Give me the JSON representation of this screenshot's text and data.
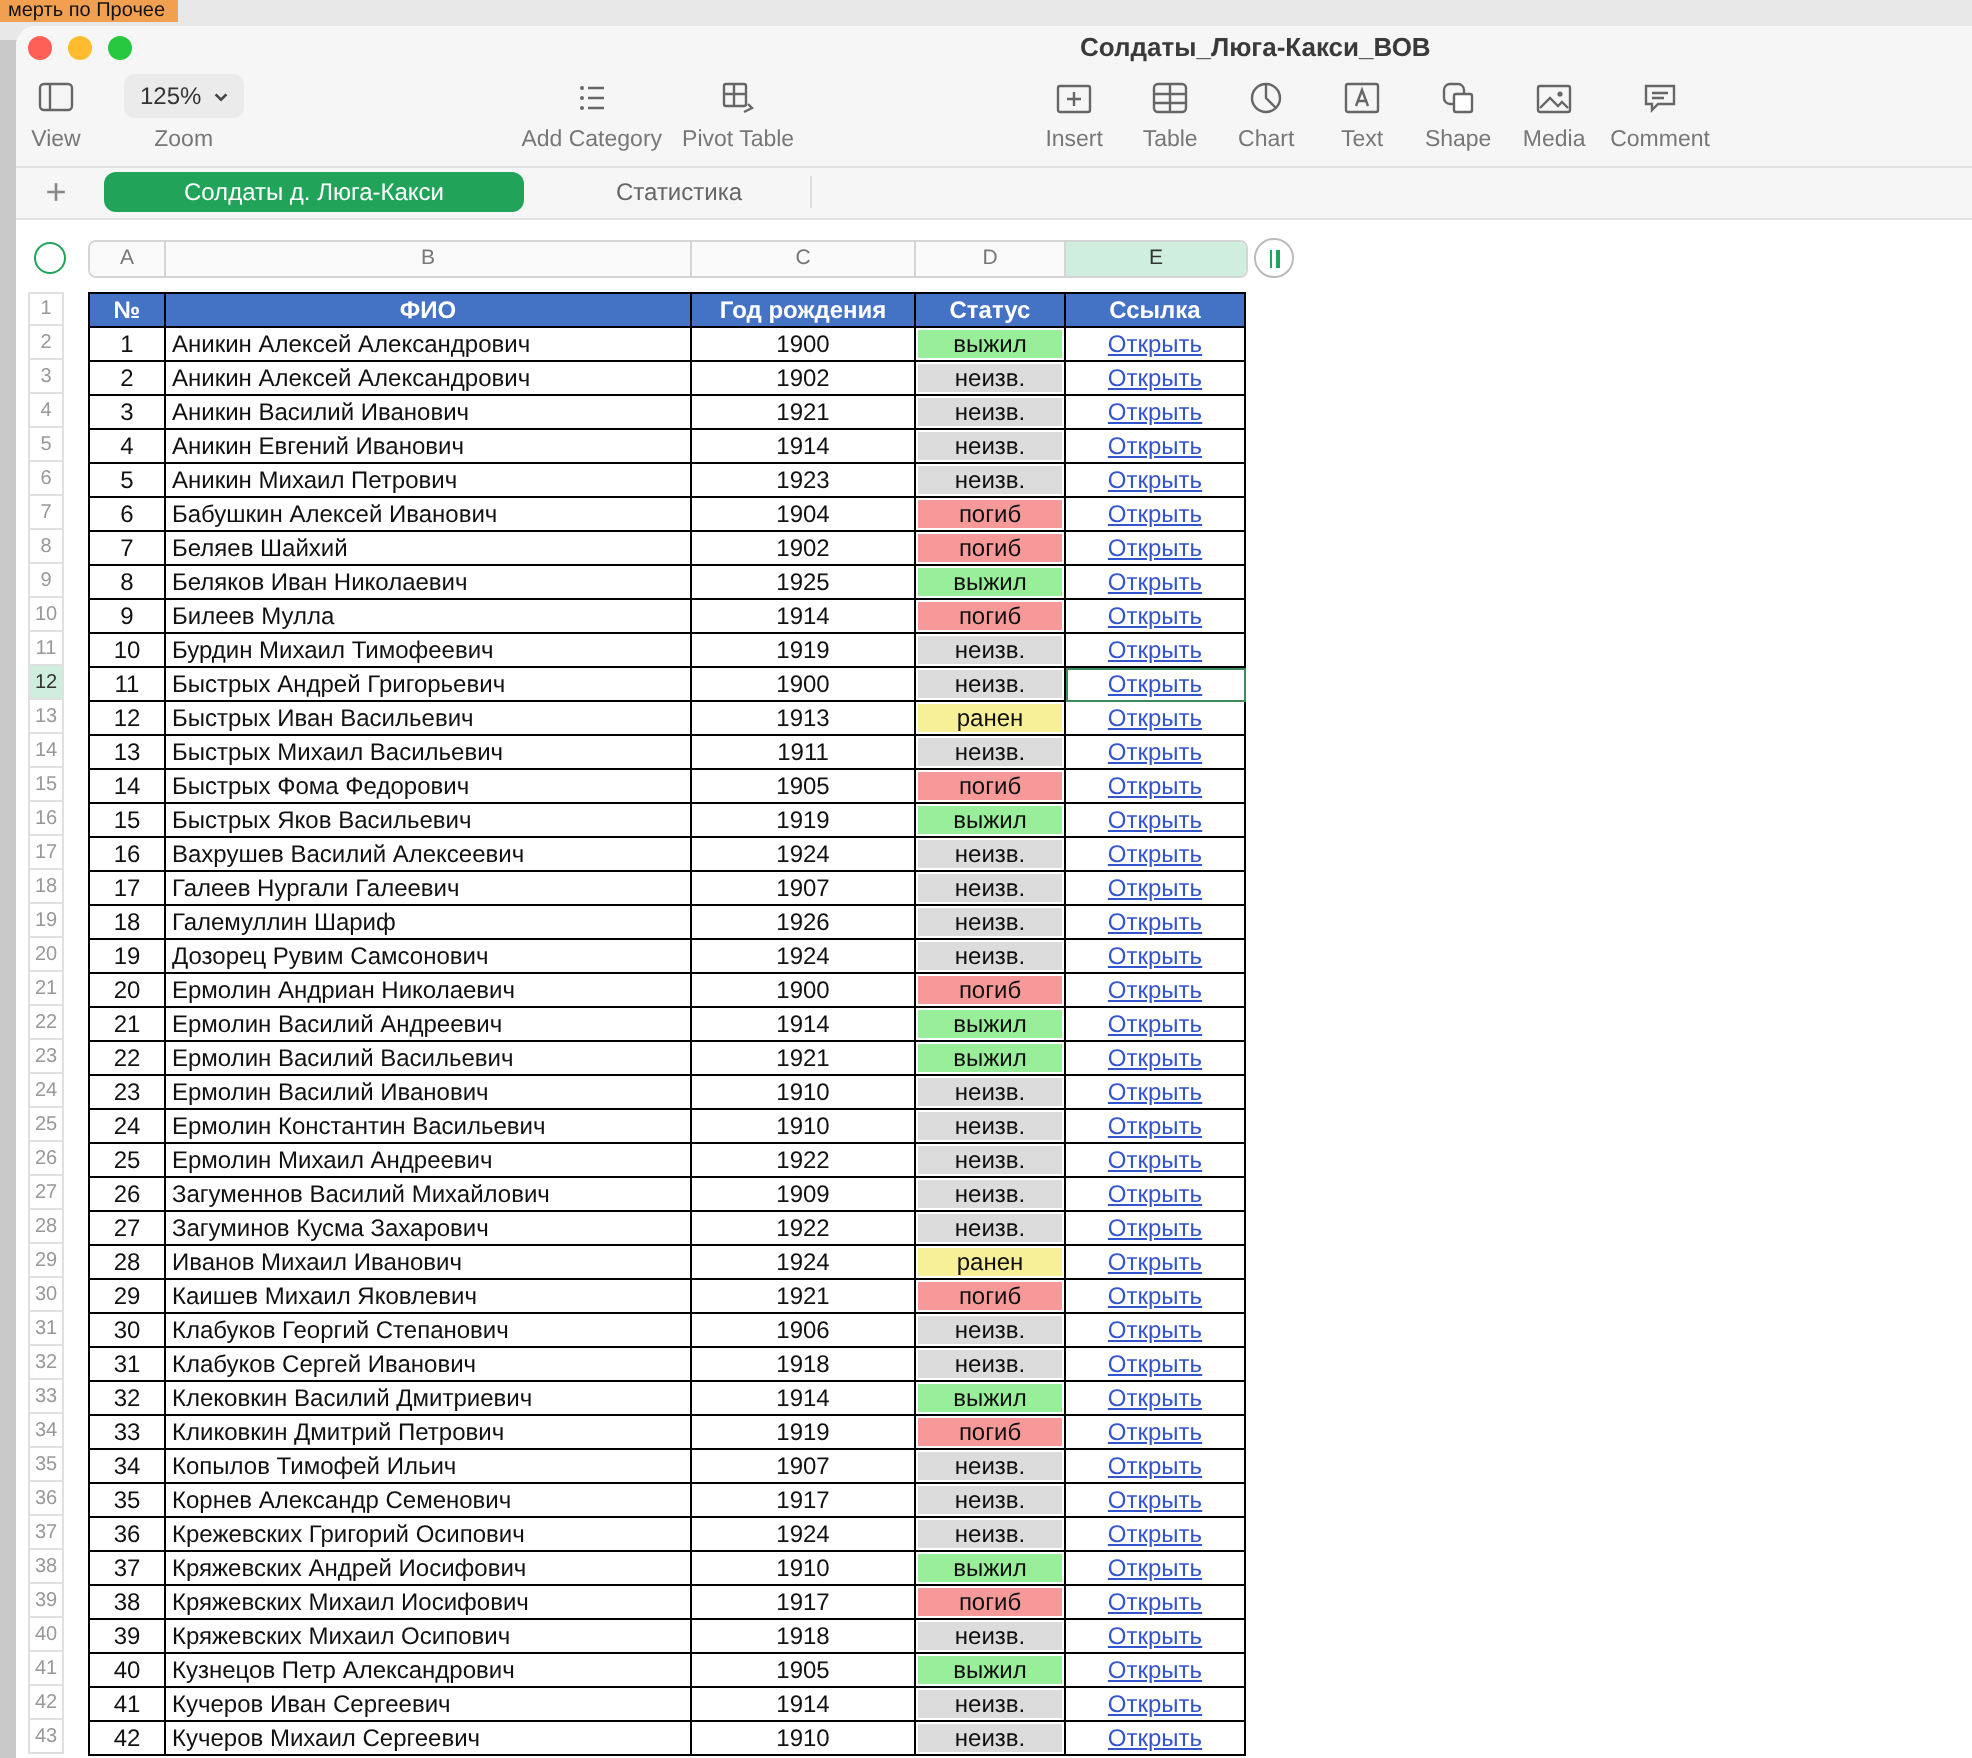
{
  "background_window": {
    "text": "мерть по  Прочее"
  },
  "window": {
    "title": "Солдаты_Люга-Какси_ВОВ"
  },
  "toolbar": [
    {
      "items": [
        {
          "kind": "view",
          "label": "View"
        },
        {
          "kind": "zoom",
          "label": "Zoom",
          "value": "125%"
        }
      ]
    },
    {
      "items": [
        {
          "kind": "category",
          "label": "Add Category"
        },
        {
          "kind": "pivot",
          "label": "Pivot Table"
        }
      ]
    },
    {
      "items": [
        {
          "kind": "insert",
          "label": "Insert"
        },
        {
          "kind": "table",
          "label": "Table"
        },
        {
          "kind": "chart",
          "label": "Chart"
        },
        {
          "kind": "text",
          "label": "Text"
        },
        {
          "kind": "shape",
          "label": "Shape"
        },
        {
          "kind": "media",
          "label": "Media"
        },
        {
          "kind": "comment",
          "label": "Comment"
        }
      ]
    }
  ],
  "add_sheet": {
    "label": "+"
  },
  "tabs": [
    {
      "label": "Солдаты д. Люга-Какси",
      "selected": true
    },
    {
      "label": "Статистика",
      "selected": false
    }
  ],
  "sheet": {
    "columns": [
      {
        "letter": "A",
        "selected": false
      },
      {
        "letter": "B",
        "selected": false
      },
      {
        "letter": "C",
        "selected": false
      },
      {
        "letter": "D",
        "selected": false
      },
      {
        "letter": "E",
        "selected": true
      }
    ],
    "header_row_label": "1",
    "headers": [
      "№",
      "ФИО",
      "Год рождения",
      "Статус",
      "Ссылка"
    ],
    "rows": [
      {
        "row_label": "2",
        "num": "1",
        "name": "Аникин Алексей Александрович",
        "year": "1900",
        "status": {
          "text": "выжил",
          "kind": "survived"
        },
        "link": "Открыть",
        "selected": false
      },
      {
        "row_label": "3",
        "num": "2",
        "name": "Аникин Алексей Александрович",
        "year": "1902",
        "status": {
          "text": "неизв.",
          "kind": "unknown"
        },
        "link": "Открыть",
        "selected": false
      },
      {
        "row_label": "4",
        "num": "3",
        "name": "Аникин Василий Иванович",
        "year": "1921",
        "status": {
          "text": "неизв.",
          "kind": "unknown"
        },
        "link": "Открыть",
        "selected": false
      },
      {
        "row_label": "5",
        "num": "4",
        "name": "Аникин Евгений Иванович",
        "year": "1914",
        "status": {
          "text": "неизв.",
          "kind": "unknown"
        },
        "link": "Открыть",
        "selected": false
      },
      {
        "row_label": "6",
        "num": "5",
        "name": "Аникин Михаил Петрович",
        "year": "1923",
        "status": {
          "text": "неизв.",
          "kind": "unknown"
        },
        "link": "Открыть",
        "selected": false
      },
      {
        "row_label": "7",
        "num": "6",
        "name": "Бабушкин Алексей Иванович",
        "year": "1904",
        "status": {
          "text": "погиб",
          "kind": "killed"
        },
        "link": "Открыть",
        "selected": false
      },
      {
        "row_label": "8",
        "num": "7",
        "name": "Беляев Шайхий",
        "year": "1902",
        "status": {
          "text": "погиб",
          "kind": "killed"
        },
        "link": "Открыть",
        "selected": false
      },
      {
        "row_label": "9",
        "num": "8",
        "name": "Беляков Иван Николаевич",
        "year": "1925",
        "status": {
          "text": "выжил",
          "kind": "survived"
        },
        "link": "Открыть",
        "selected": false
      },
      {
        "row_label": "10",
        "num": "9",
        "name": "Билеев Мулла",
        "year": "1914",
        "status": {
          "text": "погиб",
          "kind": "killed"
        },
        "link": "Открыть",
        "selected": false
      },
      {
        "row_label": "11",
        "num": "10",
        "name": "Бурдин Михаил Тимофеевич",
        "year": "1919",
        "status": {
          "text": "неизв.",
          "kind": "unknown"
        },
        "link": "Открыть",
        "selected": false
      },
      {
        "row_label": "12",
        "num": "11",
        "name": "Быстрых Андрей Григорьевич",
        "year": "1900",
        "status": {
          "text": "неизв.",
          "kind": "unknown"
        },
        "link": "Открыть",
        "selected": true
      },
      {
        "row_label": "13",
        "num": "12",
        "name": "Быстрых Иван Васильевич",
        "year": "1913",
        "status": {
          "text": "ранен",
          "kind": "wounded"
        },
        "link": "Открыть",
        "selected": false
      },
      {
        "row_label": "14",
        "num": "13",
        "name": "Быстрых Михаил Васильевич",
        "year": "1911",
        "status": {
          "text": "неизв.",
          "kind": "unknown"
        },
        "link": "Открыть",
        "selected": false
      },
      {
        "row_label": "15",
        "num": "14",
        "name": "Быстрых Фома Федорович",
        "year": "1905",
        "status": {
          "text": "погиб",
          "kind": "killed"
        },
        "link": "Открыть",
        "selected": false
      },
      {
        "row_label": "16",
        "num": "15",
        "name": "Быстрых Яков Васильевич",
        "year": "1919",
        "status": {
          "text": "выжил",
          "kind": "survived"
        },
        "link": "Открыть",
        "selected": false
      },
      {
        "row_label": "17",
        "num": "16",
        "name": "Вахрушев Василий Алексеевич",
        "year": "1924",
        "status": {
          "text": "неизв.",
          "kind": "unknown"
        },
        "link": "Открыть",
        "selected": false
      },
      {
        "row_label": "18",
        "num": "17",
        "name": "Галеев Нургали Галеевич",
        "year": "1907",
        "status": {
          "text": "неизв.",
          "kind": "unknown"
        },
        "link": "Открыть",
        "selected": false
      },
      {
        "row_label": "19",
        "num": "18",
        "name": "Галемуллин Шариф",
        "year": "1926",
        "status": {
          "text": "неизв.",
          "kind": "unknown"
        },
        "link": "Открыть",
        "selected": false
      },
      {
        "row_label": "20",
        "num": "19",
        "name": "Дозорец Рувим Самсонович",
        "year": "1924",
        "status": {
          "text": "неизв.",
          "kind": "unknown"
        },
        "link": "Открыть",
        "selected": false
      },
      {
        "row_label": "21",
        "num": "20",
        "name": "Ермолин Андриан Николаевич",
        "year": "1900",
        "status": {
          "text": "погиб",
          "kind": "killed"
        },
        "link": "Открыть",
        "selected": false
      },
      {
        "row_label": "22",
        "num": "21",
        "name": "Ермолин Василий Андреевич",
        "year": "1914",
        "status": {
          "text": "выжил",
          "kind": "survived"
        },
        "link": "Открыть",
        "selected": false
      },
      {
        "row_label": "23",
        "num": "22",
        "name": "Ермолин Василий Васильевич",
        "year": "1921",
        "status": {
          "text": "выжил",
          "kind": "survived"
        },
        "link": "Открыть",
        "selected": false
      },
      {
        "row_label": "24",
        "num": "23",
        "name": "Ермолин Василий Иванович",
        "year": "1910",
        "status": {
          "text": "неизв.",
          "kind": "unknown"
        },
        "link": "Открыть",
        "selected": false
      },
      {
        "row_label": "25",
        "num": "24",
        "name": "Ермолин Константин Васильевич",
        "year": "1910",
        "status": {
          "text": "неизв.",
          "kind": "unknown"
        },
        "link": "Открыть",
        "selected": false
      },
      {
        "row_label": "26",
        "num": "25",
        "name": "Ермолин Михаил Андреевич",
        "year": "1922",
        "status": {
          "text": "неизв.",
          "kind": "unknown"
        },
        "link": "Открыть",
        "selected": false
      },
      {
        "row_label": "27",
        "num": "26",
        "name": "Загуменнов Василий Михайлович",
        "year": "1909",
        "status": {
          "text": "неизв.",
          "kind": "unknown"
        },
        "link": "Открыть",
        "selected": false
      },
      {
        "row_label": "28",
        "num": "27",
        "name": "Загуминов Кусма Захарович",
        "year": "1922",
        "status": {
          "text": "неизв.",
          "kind": "unknown"
        },
        "link": "Открыть",
        "selected": false
      },
      {
        "row_label": "29",
        "num": "28",
        "name": "Иванов Михаил Иванович",
        "year": "1924",
        "status": {
          "text": "ранен",
          "kind": "wounded"
        },
        "link": "Открыть",
        "selected": false
      },
      {
        "row_label": "30",
        "num": "29",
        "name": "Каишев Михаил Яковлевич",
        "year": "1921",
        "status": {
          "text": "погиб",
          "kind": "killed"
        },
        "link": "Открыть",
        "selected": false
      },
      {
        "row_label": "31",
        "num": "30",
        "name": "Клабуков Георгий Степанович",
        "year": "1906",
        "status": {
          "text": "неизв.",
          "kind": "unknown"
        },
        "link": "Открыть",
        "selected": false
      },
      {
        "row_label": "32",
        "num": "31",
        "name": "Клабуков Сергей Иванович",
        "year": "1918",
        "status": {
          "text": "неизв.",
          "kind": "unknown"
        },
        "link": "Открыть",
        "selected": false
      },
      {
        "row_label": "33",
        "num": "32",
        "name": "Клековкин Василий Дмитриевич",
        "year": "1914",
        "status": {
          "text": "выжил",
          "kind": "survived"
        },
        "link": "Открыть",
        "selected": false
      },
      {
        "row_label": "34",
        "num": "33",
        "name": "Кликовкин Дмитрий Петрович",
        "year": "1919",
        "status": {
          "text": "погиб",
          "kind": "killed"
        },
        "link": "Открыть",
        "selected": false
      },
      {
        "row_label": "35",
        "num": "34",
        "name": "Копылов Тимофей Ильич",
        "year": "1907",
        "status": {
          "text": "неизв.",
          "kind": "unknown"
        },
        "link": "Открыть",
        "selected": false
      },
      {
        "row_label": "36",
        "num": "35",
        "name": "Корнев Александр Семенович",
        "year": "1917",
        "status": {
          "text": "неизв.",
          "kind": "unknown"
        },
        "link": "Открыть",
        "selected": false
      },
      {
        "row_label": "37",
        "num": "36",
        "name": "Крежевских Григорий Осипович",
        "year": "1924",
        "status": {
          "text": "неизв.",
          "kind": "unknown"
        },
        "link": "Открыть",
        "selected": false
      },
      {
        "row_label": "38",
        "num": "37",
        "name": "Кряжевских Андрей Иосифович",
        "year": "1910",
        "status": {
          "text": "выжил",
          "kind": "survived"
        },
        "link": "Открыть",
        "selected": false
      },
      {
        "row_label": "39",
        "num": "38",
        "name": "Кряжевских Михаил Иосифович",
        "year": "1917",
        "status": {
          "text": "погиб",
          "kind": "killed"
        },
        "link": "Открыть",
        "selected": false
      },
      {
        "row_label": "40",
        "num": "39",
        "name": "Кряжевских Михаил Осипович",
        "year": "1918",
        "status": {
          "text": "неизв.",
          "kind": "unknown"
        },
        "link": "Открыть",
        "selected": false
      },
      {
        "row_label": "41",
        "num": "40",
        "name": "Кузнецов Петр Александрович",
        "year": "1905",
        "status": {
          "text": "выжил",
          "kind": "survived"
        },
        "link": "Открыть",
        "selected": false
      },
      {
        "row_label": "42",
        "num": "41",
        "name": "Кучеров Иван Сергеевич",
        "year": "1914",
        "status": {
          "text": "неизв.",
          "kind": "unknown"
        },
        "link": "Открыть",
        "selected": false
      },
      {
        "row_label": "43",
        "num": "42",
        "name": "Кучеров Михаил Сергеевич",
        "year": "1910",
        "status": {
          "text": "неизв.",
          "kind": "unknown"
        },
        "link": "Открыть",
        "selected": false
      }
    ]
  }
}
